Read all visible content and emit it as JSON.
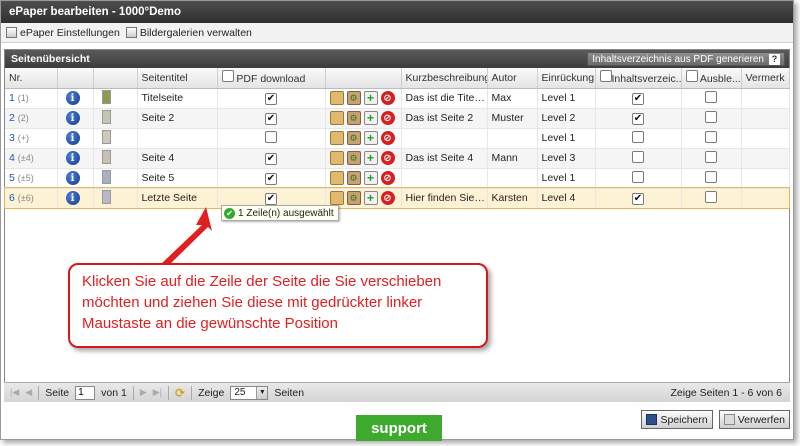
{
  "window": {
    "title": "ePaper bearbeiten - 1000°Demo"
  },
  "menu": [
    {
      "label": "ePaper Einstellungen",
      "icon": "settings-icon"
    },
    {
      "label": "Bildergalerien verwalten",
      "icon": "gallery-icon"
    }
  ],
  "panel": {
    "title": "Seitenübersicht",
    "pdf_button": "Inhaltsverzeichnis aus PDF generieren",
    "help": "?"
  },
  "columns": [
    "Nr.",
    "",
    "",
    "Seitentitel",
    "PDF download",
    "",
    "Kurzbeschreibung",
    "Autor",
    "Einrückung",
    "Inhaltsverzeic...",
    "Ausble...",
    "Vermerk"
  ],
  "rows": [
    {
      "nr": "1",
      "sub": "(1)",
      "title": "Titelseite",
      "pdf": true,
      "desc": "Das ist die Titelseite",
      "author": "Max",
      "indent": "Level 1",
      "toc": true,
      "hide": false,
      "thumb": "#8a9a50"
    },
    {
      "nr": "2",
      "sub": "(2)",
      "title": "Seite 2",
      "pdf": true,
      "desc": "Das ist Seite 2",
      "author": "Muster",
      "indent": "Level 2",
      "toc": true,
      "hide": false,
      "thumb": "#c0c8b0"
    },
    {
      "nr": "3",
      "sub": "(+)",
      "title": "",
      "pdf": false,
      "desc": "",
      "author": "",
      "indent": "Level 1",
      "toc": false,
      "hide": false,
      "thumb": "#d0c8b8"
    },
    {
      "nr": "4",
      "sub": "(±4)",
      "title": "Seite 4",
      "pdf": true,
      "desc": "Das ist Seite 4",
      "author": "Mann",
      "indent": "Level 3",
      "toc": false,
      "hide": false,
      "thumb": "#c8c0b0"
    },
    {
      "nr": "5",
      "sub": "(±5)",
      "title": "Seite 5",
      "pdf": true,
      "desc": "",
      "author": "",
      "indent": "Level 1",
      "toc": false,
      "hide": false,
      "thumb": "#a8b0c0"
    },
    {
      "nr": "6",
      "sub": "(±6)",
      "title": "Letzte Seite",
      "pdf": true,
      "desc": "Hier finden Sie w...",
      "author": "Karsten",
      "indent": "Level 4",
      "toc": true,
      "hide": false,
      "thumb": "#b8b8c8"
    }
  ],
  "tooltip": "1 Zeile(n) ausgewählt",
  "callout": "Klicken Sie auf die Zeile der Seite die Sie verschieben möchten und ziehen Sie diese mit gedrückter linker Maustaste an die gewünschte Position",
  "pager": {
    "page_label": "Seite",
    "page_value": "1",
    "of_label": "von 1",
    "show_label": "Zeige",
    "per_page": "25",
    "pages_label": "Seiten",
    "summary": "Zeige Seiten 1 - 6 von 6"
  },
  "buttons": {
    "save": "Speichern",
    "cancel": "Verwerfen"
  },
  "support": "support",
  "colors": {
    "selected_row": "#fdf3d4",
    "callout": "#e02020",
    "support": "#3daa2e"
  }
}
